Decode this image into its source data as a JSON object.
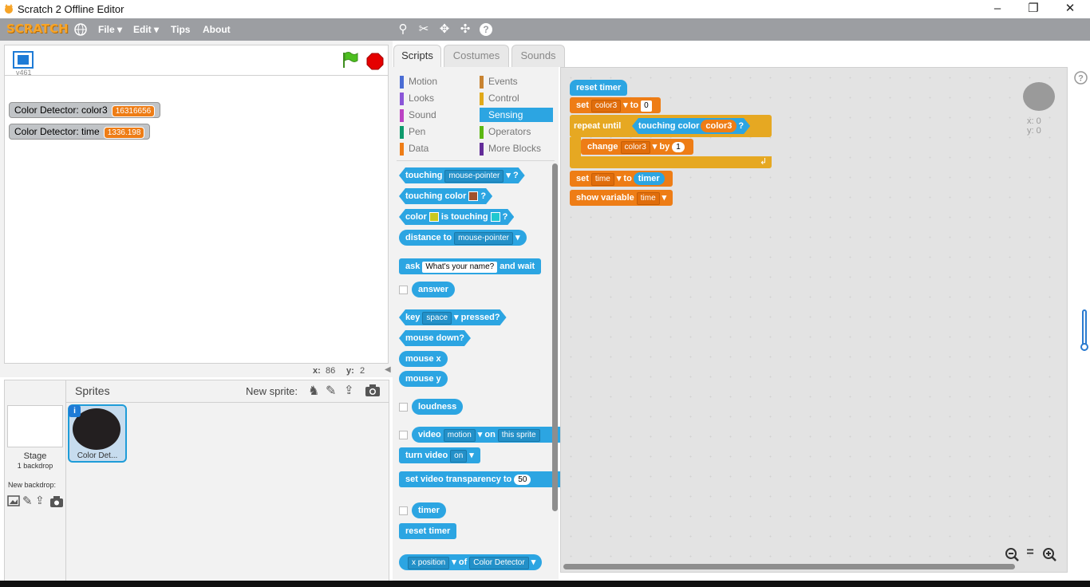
{
  "window": {
    "title": "Scratch 2 Offline Editor",
    "minimize": "–",
    "restore": "❐",
    "close": "✕"
  },
  "menubar": {
    "logo": "SCRATCH",
    "items": [
      "File ▾",
      "Edit ▾",
      "Tips",
      "About"
    ],
    "tools": [
      "stamp-icon",
      "cut-icon",
      "grow-icon",
      "shrink-icon",
      "help-icon"
    ]
  },
  "stage": {
    "version": "v461",
    "monitors": [
      {
        "label": "Color Detector: color3",
        "value": "16316656"
      },
      {
        "label": "Color Detector: time",
        "value": "1336.198"
      }
    ],
    "x_label": "x:",
    "x_value": "86",
    "y_label": "y:",
    "y_value": "2"
  },
  "sprites": {
    "title": "Sprites",
    "new_sprite": "New sprite:",
    "stage_label": "Stage",
    "stage_sub": "1 backdrop",
    "new_backdrop": "New backdrop:",
    "sprite_name": "Color Det..."
  },
  "tabs": [
    "Scripts",
    "Costumes",
    "Sounds"
  ],
  "categories": {
    "left": [
      {
        "name": "Motion",
        "color": "#4a6cd4"
      },
      {
        "name": "Looks",
        "color": "#8a55d7"
      },
      {
        "name": "Sound",
        "color": "#bb42c3"
      },
      {
        "name": "Pen",
        "color": "#0e9a6c"
      },
      {
        "name": "Data",
        "color": "#ee7d16"
      }
    ],
    "right": [
      {
        "name": "Events",
        "color": "#c88330"
      },
      {
        "name": "Control",
        "color": "#e1a91a"
      },
      {
        "name": "Sensing",
        "color": "#2ca5e2"
      },
      {
        "name": "Operators",
        "color": "#5cb712"
      },
      {
        "name": "More Blocks",
        "color": "#632d99"
      }
    ]
  },
  "palette": {
    "touching": "touching",
    "mouse_pointer": "mouse-pointer",
    "q": "?",
    "touching_color": "touching color",
    "color": "color",
    "is_touching": "is touching",
    "distance_to": "distance to",
    "ask": "ask",
    "ask_default": "What's your name?",
    "and_wait": "and wait",
    "answer": "answer",
    "key": "key",
    "space": "space",
    "pressed": "pressed?",
    "mouse_down": "mouse down?",
    "mouse_x": "mouse x",
    "mouse_y": "mouse y",
    "loudness": "loudness",
    "video": "video",
    "motion": "motion",
    "on": "on",
    "this_sprite": "this sprite",
    "turn_video": "turn video",
    "on_opt": "on",
    "set_video_transparency": "set video transparency to",
    "transparency_value": "50",
    "timer": "timer",
    "reset_timer": "reset timer",
    "x_position": "x position",
    "of": "of",
    "color_detector": "Color Detector"
  },
  "script": {
    "reset_timer": "reset timer",
    "set": "set",
    "color3": "color3",
    "to": "to",
    "zero": "0",
    "repeat_until": "repeat until",
    "touching_color": "touching color",
    "q": "?",
    "change": "change",
    "by": "by",
    "one": "1",
    "time": "time",
    "timer": "timer",
    "show_variable": "show variable"
  },
  "sprite_info": {
    "x": "x: 0",
    "y": "y: 0"
  },
  "colors": {
    "touch_swatch": "#a0522d",
    "color_swatch1": "#c8c81e",
    "color_swatch2": "#20c8d0"
  }
}
